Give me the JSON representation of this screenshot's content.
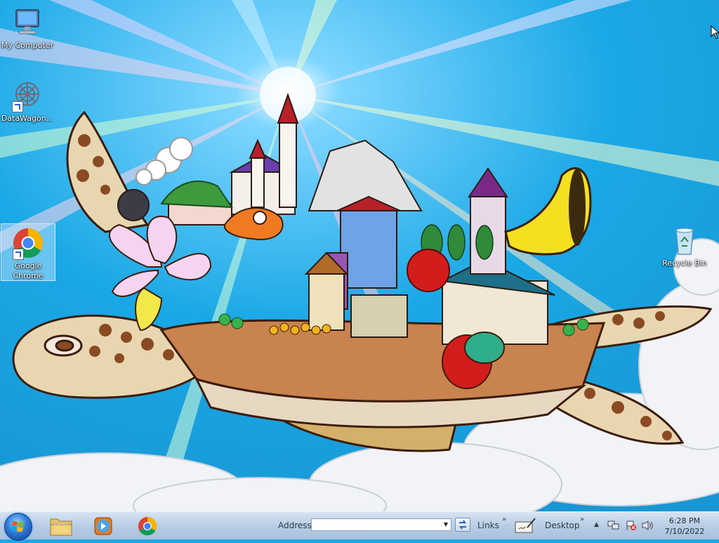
{
  "desktop": {
    "icons": [
      {
        "label": "My Computer",
        "icon": "computer-icon"
      },
      {
        "label": "DataWagon...",
        "icon": "datawagon-icon"
      },
      {
        "label": "Google Chrome",
        "icon": "chrome-icon"
      },
      {
        "label": "Recycle Bin",
        "icon": "recycle-bin-icon"
      }
    ],
    "wallpaper": "sea-turtle-castle-wallpaper"
  },
  "taskbar": {
    "start_icon": "windows-start-orb",
    "pinned": [
      {
        "name": "Windows Explorer",
        "icon": "folder-icon"
      },
      {
        "name": "Windows Media Player",
        "icon": "media-player-icon"
      },
      {
        "name": "Google Chrome",
        "icon": "chrome-icon"
      }
    ],
    "address_label": "Address",
    "address_value": "",
    "links_label": "Links",
    "desktop_label": "Desktop",
    "chevron": "»",
    "tray_up": "▲",
    "clock_time": "6:28 PM",
    "clock_date": "7/10/2022"
  },
  "colors": {
    "sky": "#1aa8e6",
    "taskbar": "#b9cde4",
    "selection": "#cde6ff"
  }
}
